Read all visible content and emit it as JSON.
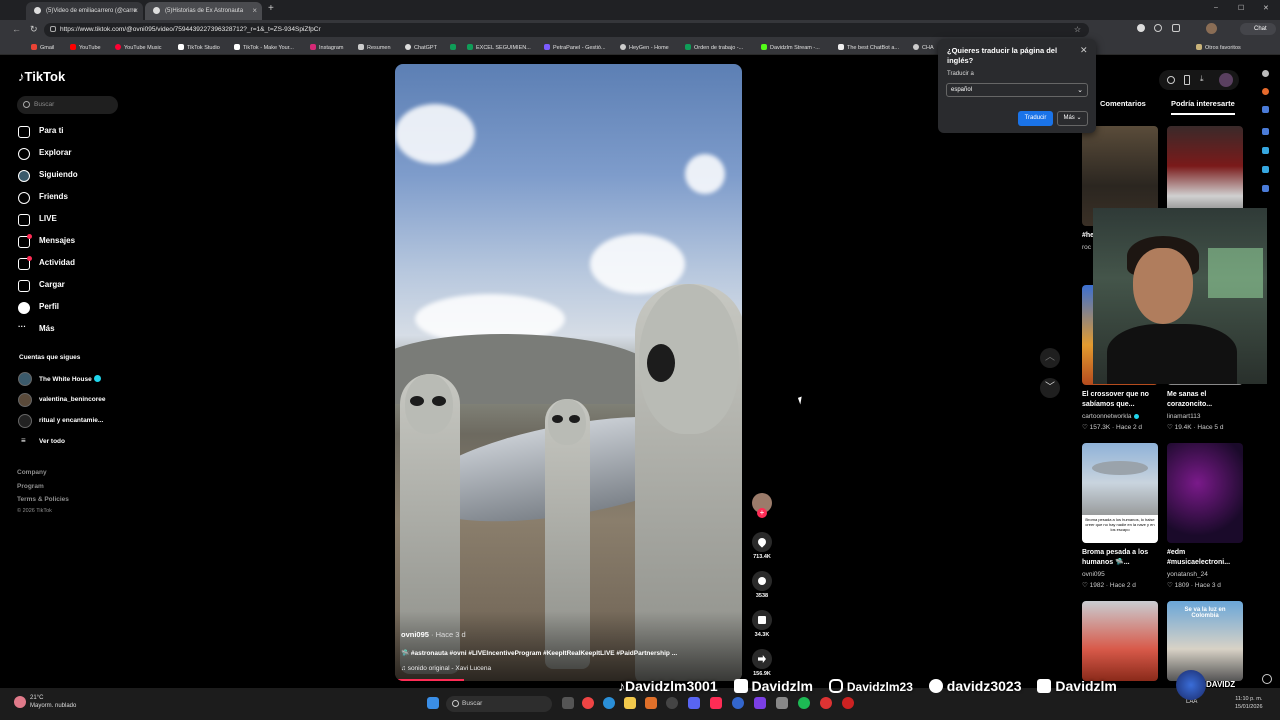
{
  "browser": {
    "tabs": [
      {
        "label": "(5)Video de emiliacarrero (@carre"
      },
      {
        "label": "(5)Historias de Ex Astronauta"
      }
    ],
    "new_tab": "+",
    "url": "https://www.tiktok.com/@ovni095/video/7594439227396328712?_r=1&_t=ZS-934SpiZfpCr",
    "window_controls": [
      "–",
      "☐",
      "✕"
    ],
    "bookmarks": [
      "Gmail",
      "YouTube",
      "YouTube Music",
      "TikTok Studio",
      "TikTok - Make Your...",
      "Instagram",
      "Resumen",
      "ChatGPT",
      "",
      "EXCEL SEGUIMIEN...",
      "PetraPanel - Gestió...",
      "HeyGen - Home",
      "Orden de trabajo -...",
      "Davidzlm Stream -...",
      "The best ChatBot a...",
      "CHA"
    ],
    "other_bookmarks": "Otros favoritos",
    "chat_label": "Chat"
  },
  "sidebar": {
    "logo": "TikTok",
    "search_placeholder": "Buscar",
    "nav": [
      "Para ti",
      "Explorar",
      "Siguiendo",
      "Friends",
      "LIVE",
      "Mensajes",
      "Actividad",
      "Cargar",
      "Perfil",
      "Más"
    ],
    "following_heading": "Cuentas que sigues",
    "following": [
      "The White House",
      "valentina_benincoree",
      "ritual y encantamie..."
    ],
    "see_all": "Ver todo",
    "footer": [
      "Company",
      "Program",
      "Terms & Policies",
      "© 2026 TikTok"
    ]
  },
  "video": {
    "username": "ovni095",
    "posted": "· Hace 3 d",
    "caption": "🛸 #astronauta #ovni #LIVEIncentiveProgram #KeepItRealKeepItLIVE #PaidPartnership ...",
    "sound": "sonido original - Xavi Lucena",
    "progress": 0.2
  },
  "actions": {
    "likes": "713.4K",
    "comments": "3538",
    "saves": "34.3K",
    "shares": "156.9K"
  },
  "translate_popup": {
    "title": "¿Quieres traducir la página del inglés?",
    "translate_to_label": "Traducir a",
    "language": "español",
    "translate_button": "Traducir",
    "more_button": "Más"
  },
  "right_panel": {
    "tabs": [
      "Comentarios",
      "Podría interesarte"
    ],
    "videos": [
      {
        "title": "El crossover que no sabíamos que...",
        "author": "cartoonnetworkla",
        "likes": "157.3K",
        "age": "Hace 2 d"
      },
      {
        "title": "Me sanas el corazoncito...",
        "author": "linamart113",
        "likes": "19.4K",
        "age": "Hace 5 d"
      },
      {
        "title": "Broma pesada a los humanos 🛸...",
        "author": "ovni095",
        "likes": "1982",
        "age": "Hace 2 d"
      },
      {
        "title": "#edm #musicaelectroni...",
        "author": "yonatansh_24",
        "likes": "1809",
        "age": "Hace 3 d"
      }
    ],
    "partial_labels": [
      "#he",
      "roc"
    ],
    "thumb_overlay": "Broma pesada a los humanos, lo haise creer que no hay nadie en la nave y en los escapo",
    "thumb_overlay2": "Se va la luz en Colombia"
  },
  "streamer": {
    "socials": [
      "Davidzlm3001",
      "Davidzlm",
      "Davidzlm23",
      "davidz3023",
      "Davidzlm"
    ],
    "badge": "DAVIDZ"
  },
  "taskbar": {
    "weather_temp": "21°C",
    "weather_desc": "Mayorm. nublado",
    "search_placeholder": "Buscar",
    "lang": "LAA",
    "time": "11:10 p. m.",
    "date": "15/01/2026"
  }
}
